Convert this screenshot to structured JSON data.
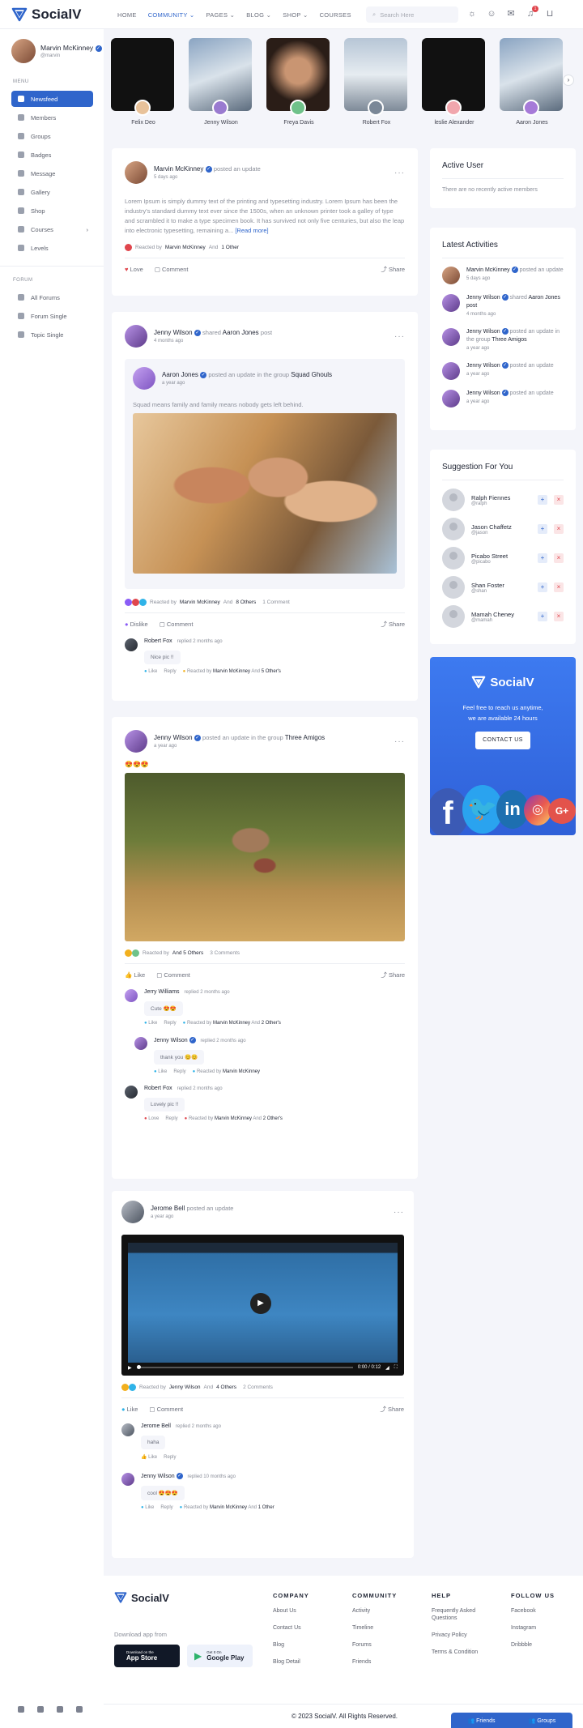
{
  "app": {
    "name": "SocialV"
  },
  "nav": {
    "items": [
      "HOME",
      "COMMUNITY",
      "PAGES",
      "BLOG",
      "SHOP",
      "COURSES"
    ],
    "active": "COMMUNITY"
  },
  "search": {
    "placeholder": "Search Here"
  },
  "header_icons": [
    "sun-icon",
    "user-icon",
    "mail-icon",
    "bell-icon",
    "cart-icon"
  ],
  "notifications": {
    "count": "1"
  },
  "profile": {
    "name": "Marvin McKinney",
    "handle": "@marvin"
  },
  "menu": {
    "label": "MENU",
    "items": [
      "Newsfeed",
      "Members",
      "Groups",
      "Badges",
      "Message",
      "Gallery",
      "Shop",
      "Courses",
      "Levels"
    ],
    "active": "Newsfeed"
  },
  "forum": {
    "label": "FORUM",
    "items": [
      "All Forums",
      "Forum Single",
      "Topic Single"
    ]
  },
  "stories": [
    {
      "name": "Felix Deo"
    },
    {
      "name": "Jenny Wilson"
    },
    {
      "name": "Freya Davis"
    },
    {
      "name": "Robert Fox"
    },
    {
      "name": "leslie Alexander"
    },
    {
      "name": "Aaron Jones"
    }
  ],
  "post1": {
    "author": "Marvin McKinney",
    "action": "posted an update",
    "time": "5 days ago",
    "body": "Lorem Ipsum is simply dummy text of the printing and typesetting industry. Lorem Ipsum has been the industry's standard dummy text ever since the 1500s, when an unknown printer took a galley of type and scrambled it to make a type specimen book. It has survived not only five centuries, but also the leap into electronic typesetting, remaining a...",
    "read_more": "[Read more]",
    "reacted_prefix": "Reacted by",
    "reacted_name": "Marvin McKinney",
    "reacted_and": "And",
    "reacted_rest": "1 Other",
    "like": "Love",
    "comment": "Comment",
    "share": "Share"
  },
  "post2": {
    "author": "Jenny Wilson",
    "action": "shared",
    "shared_name": "Aaron Jones",
    "shared_suffix": "post",
    "time": "4 months ago",
    "inner_author": "Aaron Jones",
    "inner_action": "posted an update in the group",
    "inner_group": "Squad Ghouls",
    "inner_time": "a year ago",
    "inner_text": "Squad means family and family means nobody gets left behind.",
    "reacted_prefix": "Reacted by",
    "reacted_name": "Marvin McKinney",
    "reacted_and": "And",
    "reacted_rest": "8 Others",
    "comments": "1 Comment",
    "like": "Dislike",
    "comment": "Comment",
    "share": "Share",
    "c1": {
      "name": "Robert Fox",
      "time": "replied 2 months ago",
      "text": "Nice pic !!",
      "like": "Like",
      "reply": "Reply",
      "reacted": "Reacted by",
      "rname": "Marvin McKinney",
      "rand": "And",
      "rrest": "5 Other's"
    }
  },
  "post3": {
    "author": "Jenny Wilson",
    "action": "posted an update in the group",
    "group": "Three Amigos",
    "time": "a year ago",
    "emoji": "😍😍😍",
    "reacted_prefix": "Reacted by",
    "reacted_rest": "And 5 Others",
    "comments": "3 Comments",
    "like": "Like",
    "comment": "Comment",
    "share": "Share",
    "c1": {
      "name": "Jerry Williams",
      "time": "replied 2 months ago",
      "text": "Cute 😍😍",
      "like": "Like",
      "reply": "Reply",
      "reacted": "Reacted by",
      "rname": "Marvin McKinney",
      "rand": "And",
      "rrest": "2 Other's"
    },
    "c2": {
      "name": "Jenny Wilson",
      "time": "replied 2 months ago",
      "text": "thank you 😊😊",
      "like": "Like",
      "reply": "Reply",
      "reacted": "Reacted by",
      "rname": "Marvin McKinney"
    },
    "c3": {
      "name": "Robert Fox",
      "time": "replied 2 months ago",
      "text": "Lovely pic !!",
      "like": "Love",
      "reply": "Reply",
      "reacted": "Reacted by",
      "rname": "Marvin McKinney",
      "rand": "And",
      "rrest": "2 Other's"
    }
  },
  "post4": {
    "author": "Jerome Bell",
    "action": "posted an update",
    "time": "a year ago",
    "video_time": "0:00 / 0:12",
    "reacted_prefix": "Reacted by",
    "reacted_name": "Jenny Wilson",
    "reacted_and": "And",
    "reacted_rest": "4 Others",
    "comments": "2 Comments",
    "like": "Like",
    "comment": "Comment",
    "share": "Share",
    "c1": {
      "name": "Jerome Bell",
      "time": "replied 2 months ago",
      "text": "haha",
      "like": "Like",
      "reply": "Reply"
    },
    "c2": {
      "name": "Jenny Wilson",
      "time": "replied 10 months ago",
      "text": "cool 😍😍😍",
      "like": "Like",
      "reply": "Reply",
      "reacted": "Reacted by",
      "rname": "Marvin McKinney",
      "rand": "And",
      "rrest": "1 Other"
    }
  },
  "active_user": {
    "title": "Active User",
    "empty": "There are no recently active members"
  },
  "latest": {
    "title": "Latest Activities",
    "items": [
      {
        "name": "Marvin McKinney",
        "action": "posted an update",
        "time": "5 days ago"
      },
      {
        "name": "Jenny Wilson",
        "action": "shared",
        "extra": "Aaron Jones post",
        "time": "4 months ago"
      },
      {
        "name": "Jenny Wilson",
        "action": "posted an update in the group",
        "extra": "Three Amigos",
        "time": "a year ago"
      },
      {
        "name": "Jenny Wilson",
        "action": "posted an update",
        "time": "a year ago"
      },
      {
        "name": "Jenny Wilson",
        "action": "posted an update",
        "time": "a year ago"
      }
    ]
  },
  "suggestions": {
    "title": "Suggestion For You",
    "items": [
      {
        "name": "Ralph Fiennes",
        "handle": "@ralph"
      },
      {
        "name": "Jason Chaffetz",
        "handle": "@jason"
      },
      {
        "name": "Picabo Street",
        "handle": "@picabo"
      },
      {
        "name": "Shan Foster",
        "handle": "@shan"
      },
      {
        "name": "Mamah Cheney",
        "handle": "@mamah"
      }
    ]
  },
  "promo": {
    "brand": "SocialV",
    "line1": "Feel free to reach us anytime,",
    "line2": "we are available 24 hours",
    "button": "CONTACT US"
  },
  "footer": {
    "brand": "SocialV",
    "download": "Download app from",
    "appstore_small": "Download on the",
    "appstore": "App Store",
    "gplay_small": "Get It On",
    "gplay": "Google Play",
    "company": {
      "title": "COMPANY",
      "links": [
        "About Us",
        "Contact Us",
        "Blog",
        "Blog Detail"
      ]
    },
    "community": {
      "title": "COMMUNITY",
      "links": [
        "Activity",
        "Timeline",
        "Forums",
        "Friends"
      ]
    },
    "help": {
      "title": "HELP",
      "links": [
        "Frequently Asked Questions",
        "Privacy Policy",
        "Terms & Condition"
      ]
    },
    "follow": {
      "title": "FOLLOW US",
      "links": [
        "Facebook",
        "Instagram",
        "Dribbble"
      ]
    },
    "copyright": "© 2023 SocialV. All Rights Reserved.",
    "friends": "Friends",
    "groups": "Groups"
  },
  "colors": {
    "accent": "#2f65cb",
    "background": "#f4f5fa",
    "danger": "#e0464d"
  }
}
